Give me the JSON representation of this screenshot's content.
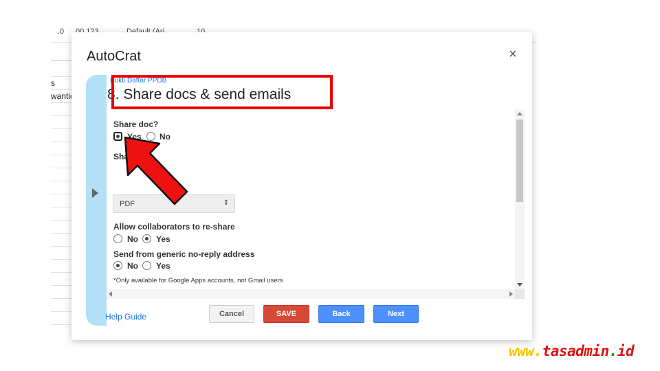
{
  "sheet": {
    "toolbar": {
      "decimal": ".0",
      "format_number": "00 123",
      "font": "Default (Ari...",
      "size": "10"
    },
    "row_texts": [
      "s",
      "wantic"
    ]
  },
  "dialog": {
    "title": "AutoCrat",
    "close_symbol": "×",
    "step_caption": "Bukti Daftar PPDB",
    "step_title": "8. Share docs & send emails",
    "share_doc": {
      "label": "Share doc?",
      "yes": "Yes",
      "no": "No",
      "selected": "Yes"
    },
    "share_as": {
      "label": "Share as",
      "value": "PDF",
      "caret": "⇕"
    },
    "reshare": {
      "label": "Allow collaborators to re-share",
      "no": "No",
      "yes": "Yes",
      "selected": "Yes"
    },
    "noreply": {
      "label": "Send from generic no-reply address",
      "no": "No",
      "yes": "Yes",
      "selected": "No"
    },
    "note": "*Only available for Google Apps accounts, not Gmail users",
    "email_icon": "envelope-icon",
    "help_link": "Help Guide",
    "buttons": {
      "cancel": "Cancel",
      "save": "SAVE",
      "back": "Back",
      "next": "Next"
    }
  },
  "watermark": {
    "part1": "www.",
    "part2": "tasadmin",
    "part3": ".",
    "part4": "id"
  },
  "colors": {
    "highlight": "#ec0000",
    "save": "#d74937",
    "primary": "#4d90fe",
    "strip": "#b3e0f6"
  }
}
